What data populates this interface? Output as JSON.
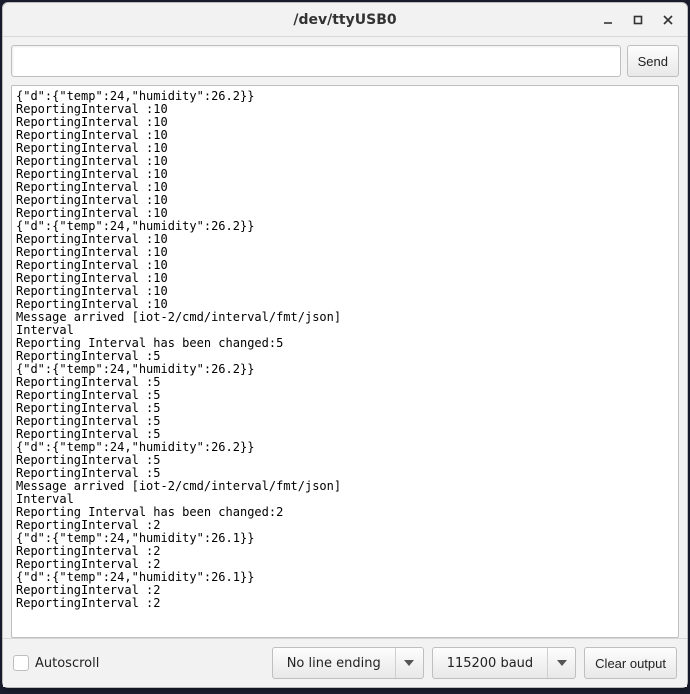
{
  "window": {
    "title": "/dev/ttyUSB0"
  },
  "toolbar": {
    "input_value": "",
    "send_label": "Send"
  },
  "output": {
    "lines": [
      "{\"d\":{\"temp\":24,\"humidity\":26.2}}",
      "ReportingInterval :10",
      "ReportingInterval :10",
      "ReportingInterval :10",
      "ReportingInterval :10",
      "ReportingInterval :10",
      "ReportingInterval :10",
      "ReportingInterval :10",
      "ReportingInterval :10",
      "ReportingInterval :10",
      "{\"d\":{\"temp\":24,\"humidity\":26.2}}",
      "ReportingInterval :10",
      "ReportingInterval :10",
      "ReportingInterval :10",
      "ReportingInterval :10",
      "ReportingInterval :10",
      "ReportingInterval :10",
      "Message arrived [iot-2/cmd/interval/fmt/json]",
      "Interval",
      "Reporting Interval has been changed:5",
      "ReportingInterval :5",
      "{\"d\":{\"temp\":24,\"humidity\":26.2}}",
      "ReportingInterval :5",
      "ReportingInterval :5",
      "ReportingInterval :5",
      "ReportingInterval :5",
      "ReportingInterval :5",
      "{\"d\":{\"temp\":24,\"humidity\":26.2}}",
      "ReportingInterval :5",
      "ReportingInterval :5",
      "Message arrived [iot-2/cmd/interval/fmt/json]",
      "Interval",
      "Reporting Interval has been changed:2",
      "ReportingInterval :2",
      "{\"d\":{\"temp\":24,\"humidity\":26.1}}",
      "ReportingInterval :2",
      "ReportingInterval :2",
      "{\"d\":{\"temp\":24,\"humidity\":26.1}}",
      "ReportingInterval :2",
      "ReportingInterval :2"
    ]
  },
  "bottom": {
    "autoscroll_label": "Autoscroll",
    "autoscroll_checked": false,
    "line_ending_label": "No line ending",
    "baud_label": "115200 baud",
    "clear_label": "Clear output"
  }
}
